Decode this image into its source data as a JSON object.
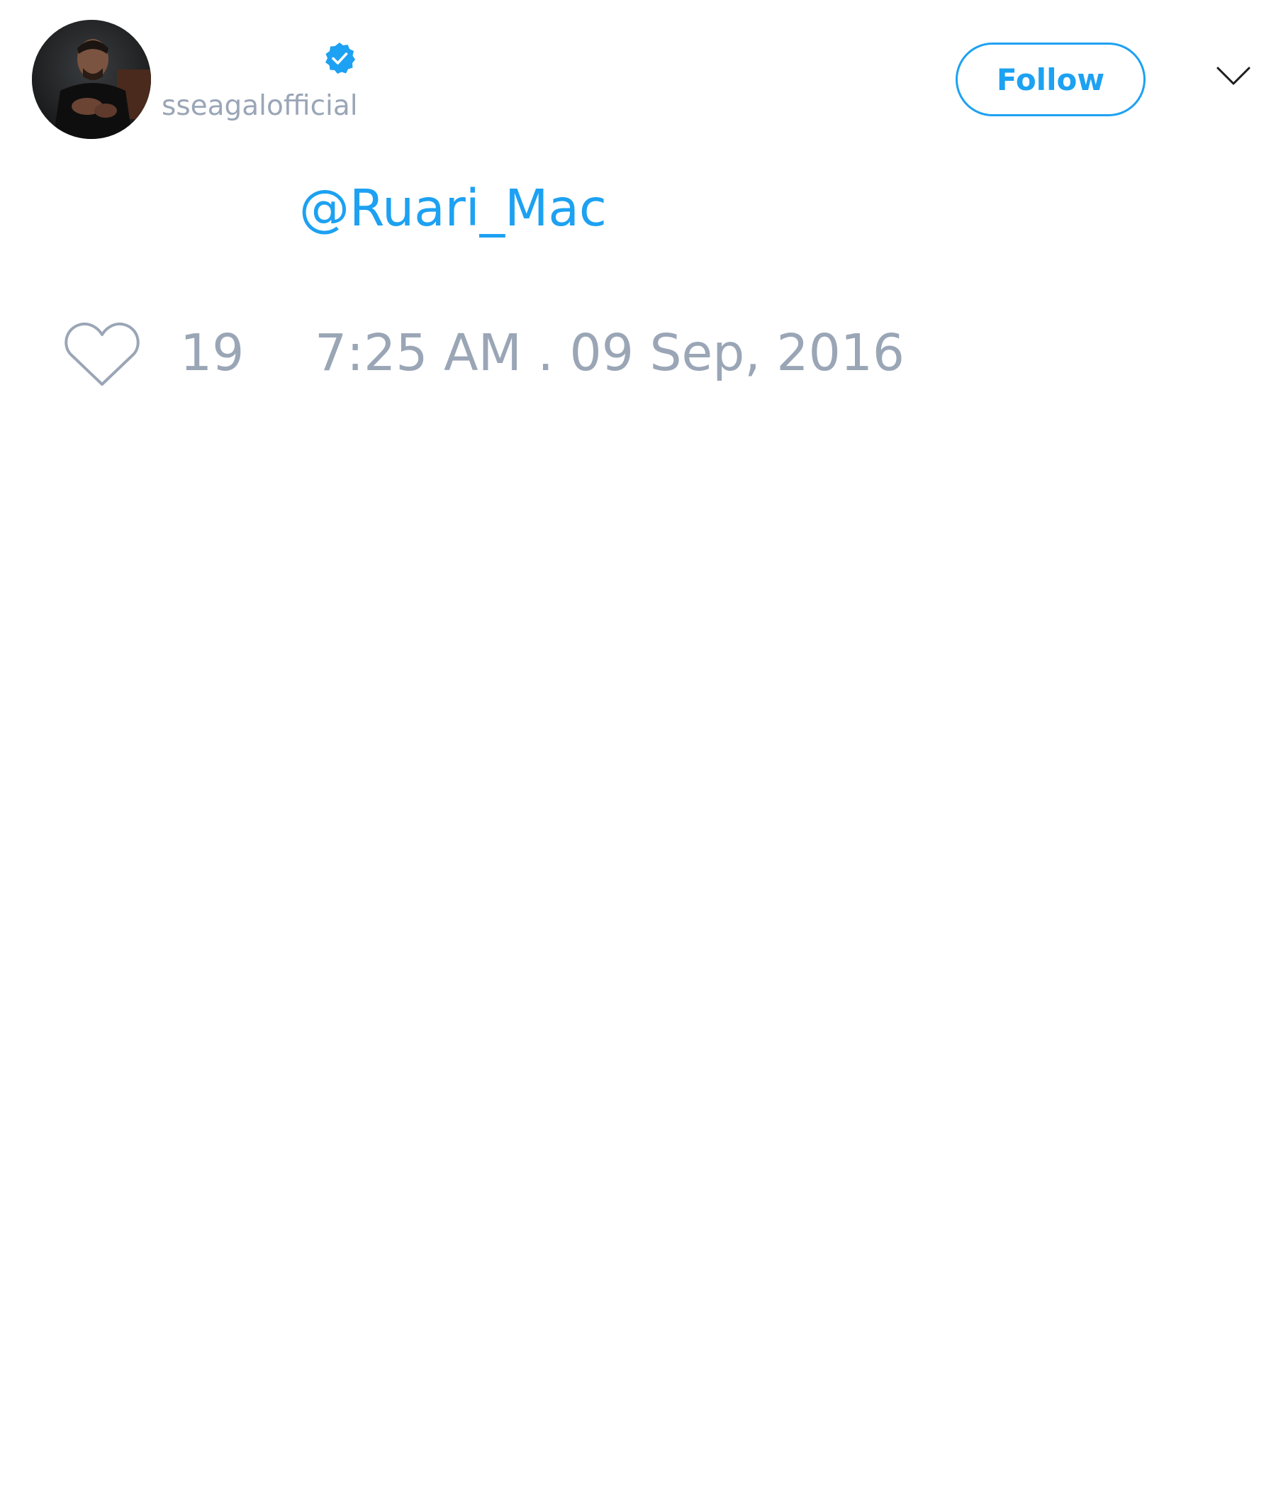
{
  "author": {
    "handle": "sseagalofficial",
    "verified": true,
    "avatar_description": "avatar"
  },
  "actions": {
    "follow_label": "Follow",
    "menu_icon": "chevron-down-icon"
  },
  "tweet": {
    "mention": "@Ruari_Mac"
  },
  "footer": {
    "like_icon": "heart-icon",
    "like_count": "19",
    "timestamp": "7:25 AM . 09 Sep, 2016"
  },
  "colors": {
    "accent": "#1da1f2",
    "muted_text": "#9aa6b6",
    "background": "#ffffff"
  }
}
